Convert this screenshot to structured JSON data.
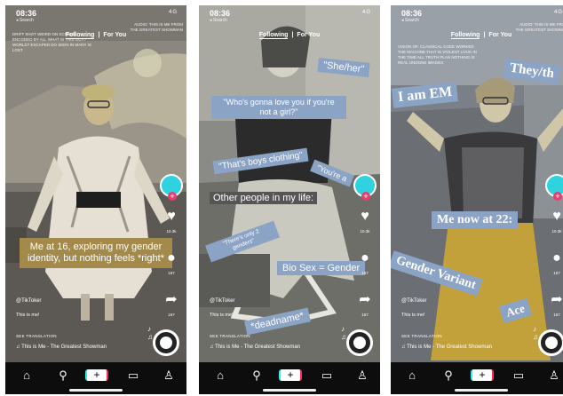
{
  "status": {
    "time": "08:36",
    "back": "◂ Search",
    "signal": "4G"
  },
  "tabs": {
    "following": "Following",
    "for_you": "For You"
  },
  "audio_caption": "AUDIO: THIS IS ME FROM THE GREATEST SHOWMAN",
  "panel1": {
    "top_caption": "DRIFT SHOT WEIRD ON SCREEN ENCODED BY ALL WHAT IS THIS GUY? WORLD? ESCAPED DO SEEN IN MANY IS LOST",
    "main_caption": "Me at 16, exploring my gender identity, but nothing feels *right*",
    "likes": "10.3k",
    "comments": "167",
    "shares": "167"
  },
  "panel2": {
    "overlays": [
      "\"She/her\"",
      "\"Who's gonna love you if you're not a girl?\"",
      "\"That's boys clothing\"",
      "\"You're a",
      "Other people in my life:",
      "\"There's only 2 genders\"",
      "Bio Sex = Gender",
      "*deadname*"
    ],
    "likes": "10.3k",
    "comments": "167",
    "shares": "167"
  },
  "panel3": {
    "top_caption": "VISION OF: CLASSICAL CODE WORKED THE MACHINE THAT IS VIOLENT LOOK IN THE TIME ALL TRUTH PLAN NOTHING IS REAL UNDONE IMAGES",
    "overlays": [
      "They/th",
      "I am EM",
      "Me now at 22:",
      "Gender Variant",
      "Ace"
    ],
    "likes": "10.3k",
    "comments": "167",
    "shares": "167"
  },
  "footer": {
    "creator": "@TikToker",
    "caption": "This is me!",
    "translation": "SEE TRANSLATION",
    "sound": "This is Me - The Greatest Showman",
    "create_plus": "+"
  },
  "colors": {
    "overlay_blue": "#8ba3c4",
    "overlay_olive": "#a38a4b",
    "avatar": "#2fd3e0",
    "plus": "#e83e6d"
  }
}
